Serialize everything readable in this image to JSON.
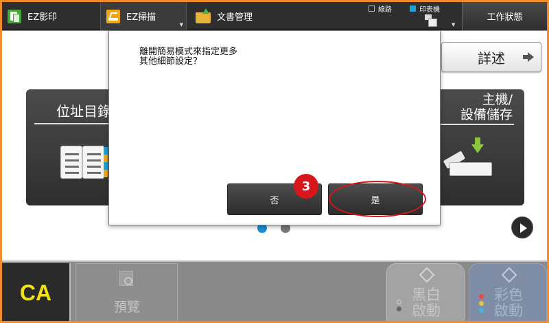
{
  "topbar": {
    "tabs": [
      {
        "label": "EZ影印",
        "icon": "copy-icon"
      },
      {
        "label": "EZ掃描",
        "icon": "scan-icon"
      },
      {
        "label": "文書管理",
        "icon": "folder-upload-icon"
      }
    ],
    "status": {
      "line_label": "線路",
      "printer_label": "印表機"
    },
    "job_status_label": "工作狀態"
  },
  "main": {
    "details_label": "詳述",
    "cards": [
      {
        "title": "位址目錄",
        "icon": "address-book-icon"
      },
      {
        "title_line1": "主機/",
        "title_line2": "設備儲存",
        "icon": "usb-storage-icon"
      }
    ],
    "page_indicator": {
      "current": 1,
      "total": 2
    }
  },
  "dialog": {
    "message": "離開簡易模式來指定更多\n其他細節設定？",
    "no_label": "否",
    "yes_label": "是",
    "step_number": "3",
    "highlight_color": "#d9161b"
  },
  "bottombar": {
    "clear_all_label": "CA",
    "preview_label": "預覽",
    "bw_start_line1": "黑白",
    "bw_start_line2": "啟動",
    "color_start_line1": "彩色",
    "color_start_line2": "啟動"
  },
  "colors": {
    "frame": "#f28c28",
    "accent_blue": "#1aa4d8",
    "ca_yellow": "#f2e21a"
  }
}
